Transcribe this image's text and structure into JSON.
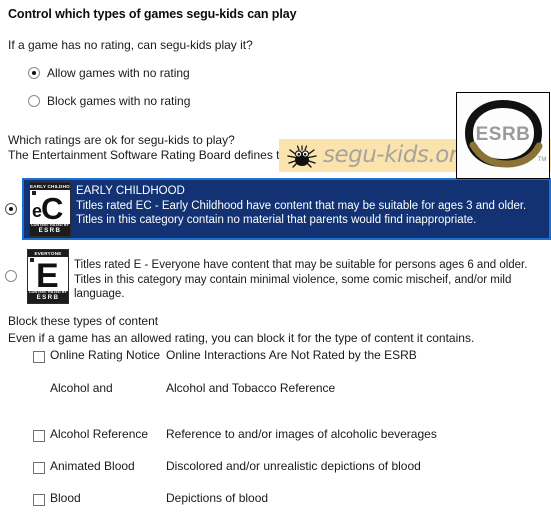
{
  "page": {
    "title": "Control which types of games segu-kids can play",
    "no_rating_question": "If a game has no rating, can segu-kids play it?",
    "ratings_question": "Which ratings are ok for segu-kids to play?",
    "ratings_board_line": "The Entertainment Software Rating Board defines these ratings.",
    "block_heading": "Block these types of content",
    "block_subheading": "Even if a game has an allowed rating, you can block it for the type of content it contains."
  },
  "no_rating_options": [
    {
      "label": "Allow games with no rating",
      "selected": true
    },
    {
      "label": "Block games with no rating",
      "selected": false
    }
  ],
  "esrb_logo": {
    "text": "ESRB",
    "trademark": "TM"
  },
  "watermark": {
    "text": "segu-kids.org",
    "icon": "spider-icon",
    "background": "#fae3ad",
    "text_color": "#a8a49a"
  },
  "ratings": [
    {
      "code": "EC",
      "selected": true,
      "title": "EARLY CHILDHOOD",
      "description": "Titles rated EC - Early Childhood have content that may be suitable for ages 3 and older.  Titles in this category contain no material that parents would find inappropriate.",
      "icon": {
        "cap": "EARLY CHILDHOOD",
        "glyph": "eC",
        "foot_top": "CONTENT RATED BY",
        "foot_bottom": "ESRB"
      }
    },
    {
      "code": "E",
      "selected": false,
      "title": "",
      "description": "Titles rated E - Everyone have content that may be suitable for persons ages 6 and older.  Titles in this category may contain minimal violence, some comic mischeif, and/or mild language.",
      "icon": {
        "cap": "EVERYONE",
        "glyph": "E",
        "foot_top": "CONTENT RATED BY",
        "foot_bottom": "ESRB"
      }
    }
  ],
  "content_descriptors": [
    {
      "label": "Online Rating Notice",
      "description": "Online Interactions Are Not Rated by the ESRB",
      "checked": false,
      "has_checkbox": true
    },
    {
      "label": "Alcohol and",
      "description": "Alcohol and Tobacco Reference",
      "checked": false,
      "has_checkbox": false
    },
    {
      "label": "Alcohol Reference",
      "description": "Reference to and/or images of alcoholic beverages",
      "checked": false,
      "has_checkbox": true
    },
    {
      "label": "Animated Blood",
      "description": "Discolored and/or unrealistic depictions of blood",
      "checked": false,
      "has_checkbox": true
    },
    {
      "label": "Blood",
      "description": "Depictions of blood",
      "checked": false,
      "has_checkbox": true
    }
  ],
  "colors": {
    "selection_fill": "#123273",
    "selection_border": "#1f6fd0",
    "watermark_bg": "#fae3ad"
  }
}
